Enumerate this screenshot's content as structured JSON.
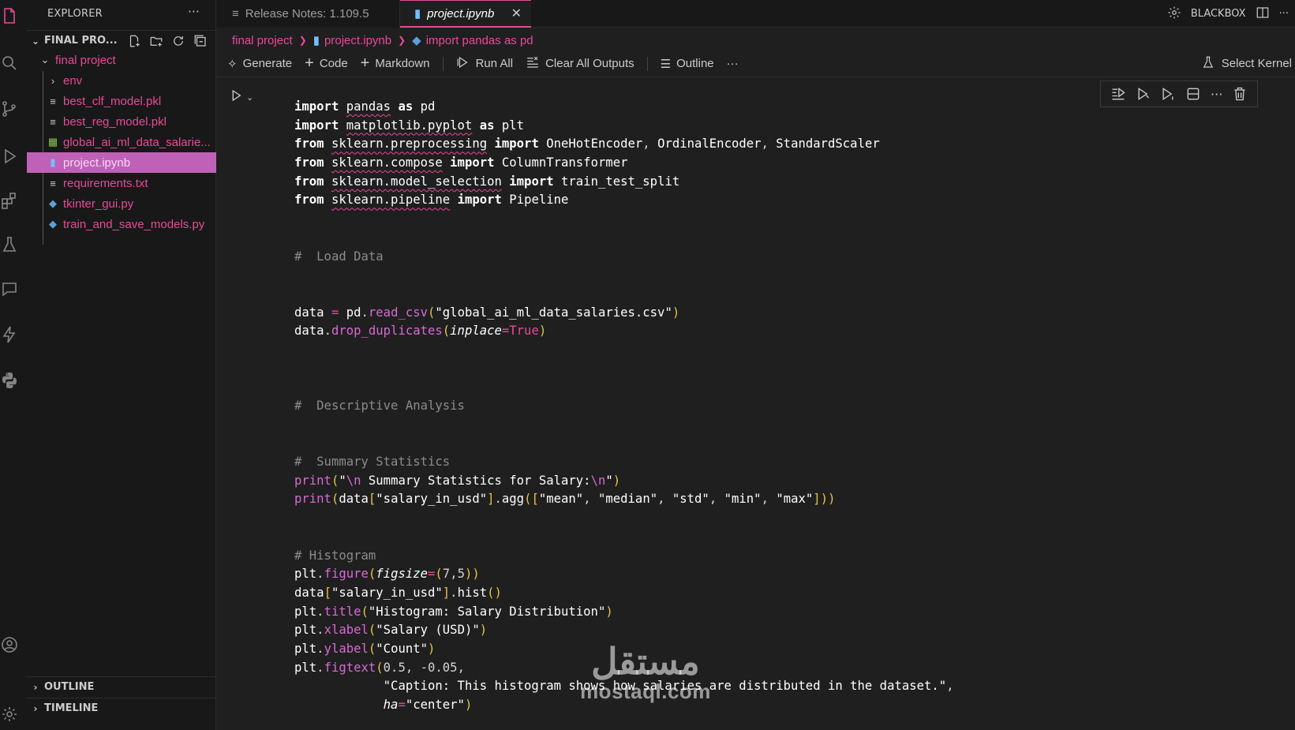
{
  "window": {
    "top_right_label": "BLACKBOX"
  },
  "explorer": {
    "title": "EXPLORER",
    "more": "···",
    "section_title": "FINAL PRO...",
    "items": [
      {
        "label": "final project",
        "type": "folder-open"
      },
      {
        "label": "env",
        "type": "folder"
      },
      {
        "label": "best_clf_model.pkl",
        "type": "file"
      },
      {
        "label": "best_reg_model.pkl",
        "type": "file"
      },
      {
        "label": "global_ai_ml_data_salarie...",
        "type": "csv"
      },
      {
        "label": "project.ipynb",
        "type": "notebook",
        "selected": true
      },
      {
        "label": "requirements.txt",
        "type": "file"
      },
      {
        "label": "tkinter_gui.py",
        "type": "python"
      },
      {
        "label": "train_and_save_models.py",
        "type": "python"
      }
    ],
    "outline": "OUTLINE",
    "timeline": "TIMELINE"
  },
  "tabs": [
    {
      "label": "Release Notes: 1.109.5",
      "active": false
    },
    {
      "label": "project.ipynb",
      "active": true
    }
  ],
  "breadcrumb": [
    "final project",
    "project.ipynb",
    "import pandas as pd"
  ],
  "notebook_toolbar": {
    "generate": "Generate",
    "code": "Code",
    "markdown": "Markdown",
    "run_all": "Run All",
    "clear_outputs": "Clear All Outputs",
    "outline": "Outline",
    "more": "···",
    "select_kernel": "Select Kernel"
  },
  "code_lines": [
    "import pandas as pd",
    "import matplotlib.pyplot as plt",
    "from sklearn.preprocessing import OneHotEncoder, OrdinalEncoder, StandardScaler",
    "from sklearn.compose import ColumnTransformer",
    "from sklearn.model_selection import train_test_split",
    "from sklearn.pipeline import Pipeline",
    "",
    "",
    "#  Load Data",
    "",
    "",
    "data = pd.read_csv(\"global_ai_ml_data_salaries.csv\")",
    "data.drop_duplicates(inplace=True)",
    "",
    "",
    "",
    "#  Descriptive Analysis",
    "",
    "",
    "#  Summary Statistics",
    "print(\"\\n Summary Statistics for Salary:\\n\")",
    "print(data[\"salary_in_usd\"].agg([\"mean\", \"median\", \"std\", \"min\", \"max\"]))",
    "",
    "",
    "# Histogram",
    "plt.figure(figsize=(7,5))",
    "data[\"salary_in_usd\"].hist()",
    "plt.title(\"Histogram: Salary Distribution\")",
    "plt.xlabel(\"Salary (USD)\")",
    "plt.ylabel(\"Count\")",
    "plt.figtext(0.5, -0.05,",
    "            \"Caption: This histogram shows how salaries are distributed in the dataset.\",",
    "            ha=\"center\")"
  ],
  "watermark": {
    "arabic": "مستقل",
    "latin": "mostaql.com"
  }
}
